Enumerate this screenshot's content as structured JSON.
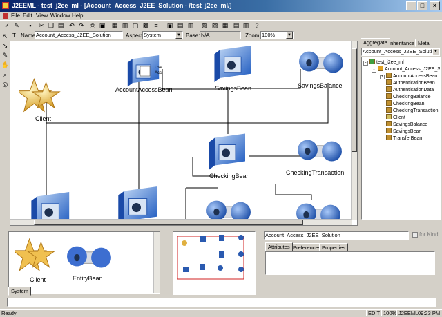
{
  "window": {
    "title": "J2EEML - test_j2ee_ml - [Account_Access_J2EE_Solution - /test_j2ee_ml/]",
    "controls": [
      "_",
      "□",
      "×"
    ]
  },
  "menu": [
    "File",
    "Edit",
    "View",
    "Window",
    "Help"
  ],
  "propbar": {
    "name_label": "Name:",
    "name_value": "Account_Access_J2EE_Solution",
    "aspect_label": "Aspect:",
    "aspect_value": "System",
    "base_label": "Base:",
    "base_value": "N/A",
    "zoom_label": "Zoom:",
    "zoom_value": "100%"
  },
  "canvas": {
    "nodes": [
      {
        "id": "client",
        "label": "Client",
        "kind": "star"
      },
      {
        "id": "account",
        "label": "AccountAccessBean",
        "kind": "cube",
        "inner": [
          "Use",
          "Acc"
        ]
      },
      {
        "id": "savingsbean",
        "label": "SavingsBean",
        "kind": "cube"
      },
      {
        "id": "savingsbalance",
        "label": "SavingsBalance",
        "kind": "cylinder"
      },
      {
        "id": "checkingbean",
        "label": "CheckingBean",
        "kind": "cube"
      },
      {
        "id": "checkingtx",
        "label": "CheckingTransaction",
        "kind": "cylinder"
      }
    ]
  },
  "rightpanel": {
    "tabs": [
      "Aggregate",
      "Inheritance",
      "Meta"
    ],
    "combo_value": "Account_Access_J2EE_Solution",
    "tree": [
      {
        "label": "test_j2ee_ml",
        "depth": 0,
        "expander": "-",
        "icon": "root-icon"
      },
      {
        "label": "Account_Access_J2EE_S",
        "depth": 1,
        "expander": "-",
        "icon": "folder-icon"
      },
      {
        "label": "AccountAccessBean",
        "depth": 2,
        "expander": "+",
        "icon": "bean-icon"
      },
      {
        "label": "AuthenticationBean",
        "depth": 2,
        "expander": "",
        "icon": "bean-icon"
      },
      {
        "label": "AuthenticationData",
        "depth": 2,
        "expander": "",
        "icon": "bean-icon"
      },
      {
        "label": "CheckingBalance",
        "depth": 2,
        "expander": "",
        "icon": "bean-icon"
      },
      {
        "label": "CheckingBean",
        "depth": 2,
        "expander": "",
        "icon": "bean-icon"
      },
      {
        "label": "CheckingTransaction",
        "depth": 2,
        "expander": "",
        "icon": "bean-icon"
      },
      {
        "label": "Client",
        "depth": 2,
        "expander": "",
        "icon": "client-icon"
      },
      {
        "label": "SavingsBalance",
        "depth": 2,
        "expander": "",
        "icon": "bean-icon"
      },
      {
        "label": "SavingsBean",
        "depth": 2,
        "expander": "",
        "icon": "bean-icon"
      },
      {
        "label": "TransferBean",
        "depth": 2,
        "expander": "",
        "icon": "bean-icon"
      }
    ]
  },
  "partbrowser": {
    "items": [
      "Client",
      "EntityBean"
    ],
    "tab": "System"
  },
  "inspector": {
    "name_value": "Account_Access_J2EE_Solution",
    "checkbox_label": "for Kind",
    "tabs": [
      "Attributes",
      "Preferences",
      "Properties"
    ]
  },
  "status": {
    "left": "Ready",
    "mode": "EDIT",
    "zoom": "100%",
    "app": "J2EEML",
    "time": "09:23 PM"
  }
}
